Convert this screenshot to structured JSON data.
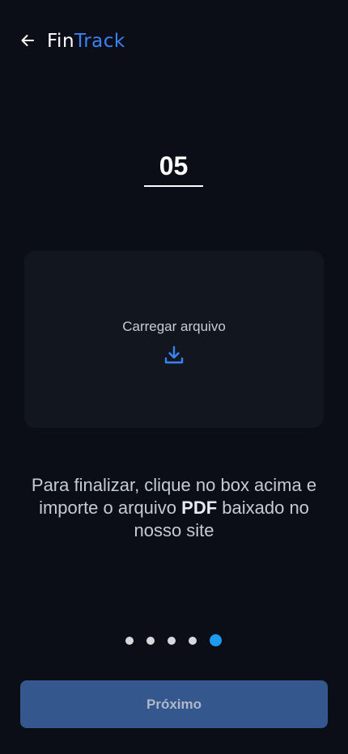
{
  "header": {
    "back_icon": "arrow-left-icon",
    "logo_part1": "Fin",
    "logo_part2": "Track",
    "logo_accent_color": "#3b82f6"
  },
  "step": {
    "number": "05"
  },
  "upload": {
    "label": "Carregar arquivo",
    "icon": "download-icon",
    "icon_color": "#3b82f6"
  },
  "instructions": {
    "line_before_bold": "Para finalizar, clique no box acima e importe o arquivo ",
    "bold": "PDF",
    "line_after_bold": " baixado no nosso site"
  },
  "pagination": {
    "total": 5,
    "active_index": 4,
    "active_color": "#1d9bf0"
  },
  "next_button": {
    "label": "Próximo"
  },
  "colors": {
    "background": "#0b0e16",
    "box": "#12171f",
    "button": "#34588e"
  }
}
